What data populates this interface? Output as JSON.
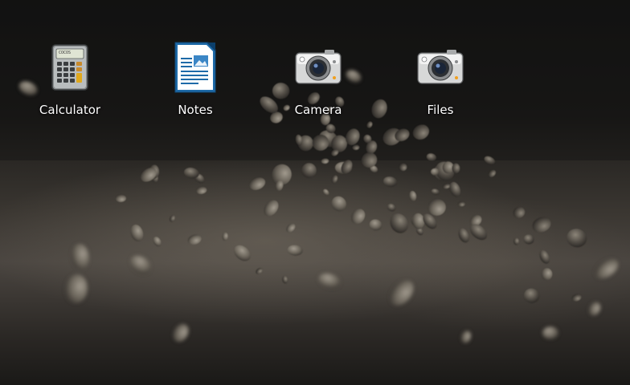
{
  "desktop": {
    "icons": [
      {
        "label": "Calculator",
        "icon": "calculator-icon"
      },
      {
        "label": "Notes",
        "icon": "document-icon"
      },
      {
        "label": "Camera",
        "icon": "camera-icon"
      },
      {
        "label": "Files",
        "icon": "camera-icon"
      }
    ]
  },
  "calculator_display": "COCOS"
}
